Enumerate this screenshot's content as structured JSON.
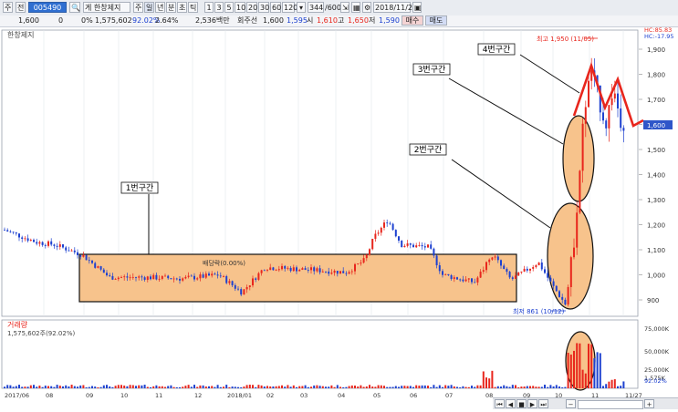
{
  "toolbar": {
    "items": [
      "주",
      "전",
      "005490",
      "키",
      "게 한창제지",
      "주",
      "일",
      "년",
      "분",
      "초",
      "틱",
      "1",
      "3",
      "5",
      "10",
      "20",
      "30",
      "60",
      "120",
      "344",
      "600",
      "2018/11/27"
    ],
    "code": "005490",
    "name": "게 한창제지",
    "count": "344",
    "of": "/600",
    "date": "2018/11/27"
  },
  "info": {
    "price": "1,600",
    "change": "0",
    "pct": "0%",
    "volume": "1,575,602",
    "ratio1": "92.02%",
    "ratio2": "2.64%",
    "amount": "2,536백만",
    "turnover_label": "회주선",
    "turnover": "1,600",
    "ma": "1,595",
    "open_label": "시",
    "open": "1,610",
    "high_label": "고",
    "high": "1,650",
    "low_label": "저",
    "low": "1,590",
    "buy": "매수",
    "sell": "매도"
  },
  "chart_data": {
    "type": "candlestick",
    "title": "한창제지",
    "price_axis": [
      "1,900",
      "1,800",
      "1,700",
      "1,600",
      "1,500",
      "1,400",
      "1,300",
      "1,200",
      "1,100",
      "1,000",
      "900"
    ],
    "price_range": [
      861,
      1950
    ],
    "current_price_label": "1,600",
    "hc_labels": [
      "HC:85.83",
      "HC:-17.95"
    ],
    "x_axis": [
      "2017/06",
      "08",
      "09",
      "10",
      "11",
      "12",
      "2018/01",
      "02",
      "03",
      "04",
      "05",
      "06",
      "07",
      "08",
      "09",
      "10",
      "11",
      "11/27"
    ],
    "annotations": [
      {
        "text": "1번구간"
      },
      {
        "text": "2번구간"
      },
      {
        "text": "3번구간"
      },
      {
        "text": "4번구간"
      },
      {
        "text": "최고 1,950 (11/05)"
      },
      {
        "text": "최저 861 (10/12)"
      },
      {
        "text": "배당락(0.00%)"
      }
    ],
    "volume": {
      "title": "거래량",
      "value_label": "1,575,602주(92.02%)",
      "axis": [
        "75,000K",
        "50,000K",
        "25,000K",
        "1,575K"
      ],
      "extra": "92.02%"
    }
  },
  "colors": {
    "up": "#e8261d",
    "down": "#1d41d0",
    "highlight": "#f7c38c",
    "zigzag": "#e8261d"
  }
}
